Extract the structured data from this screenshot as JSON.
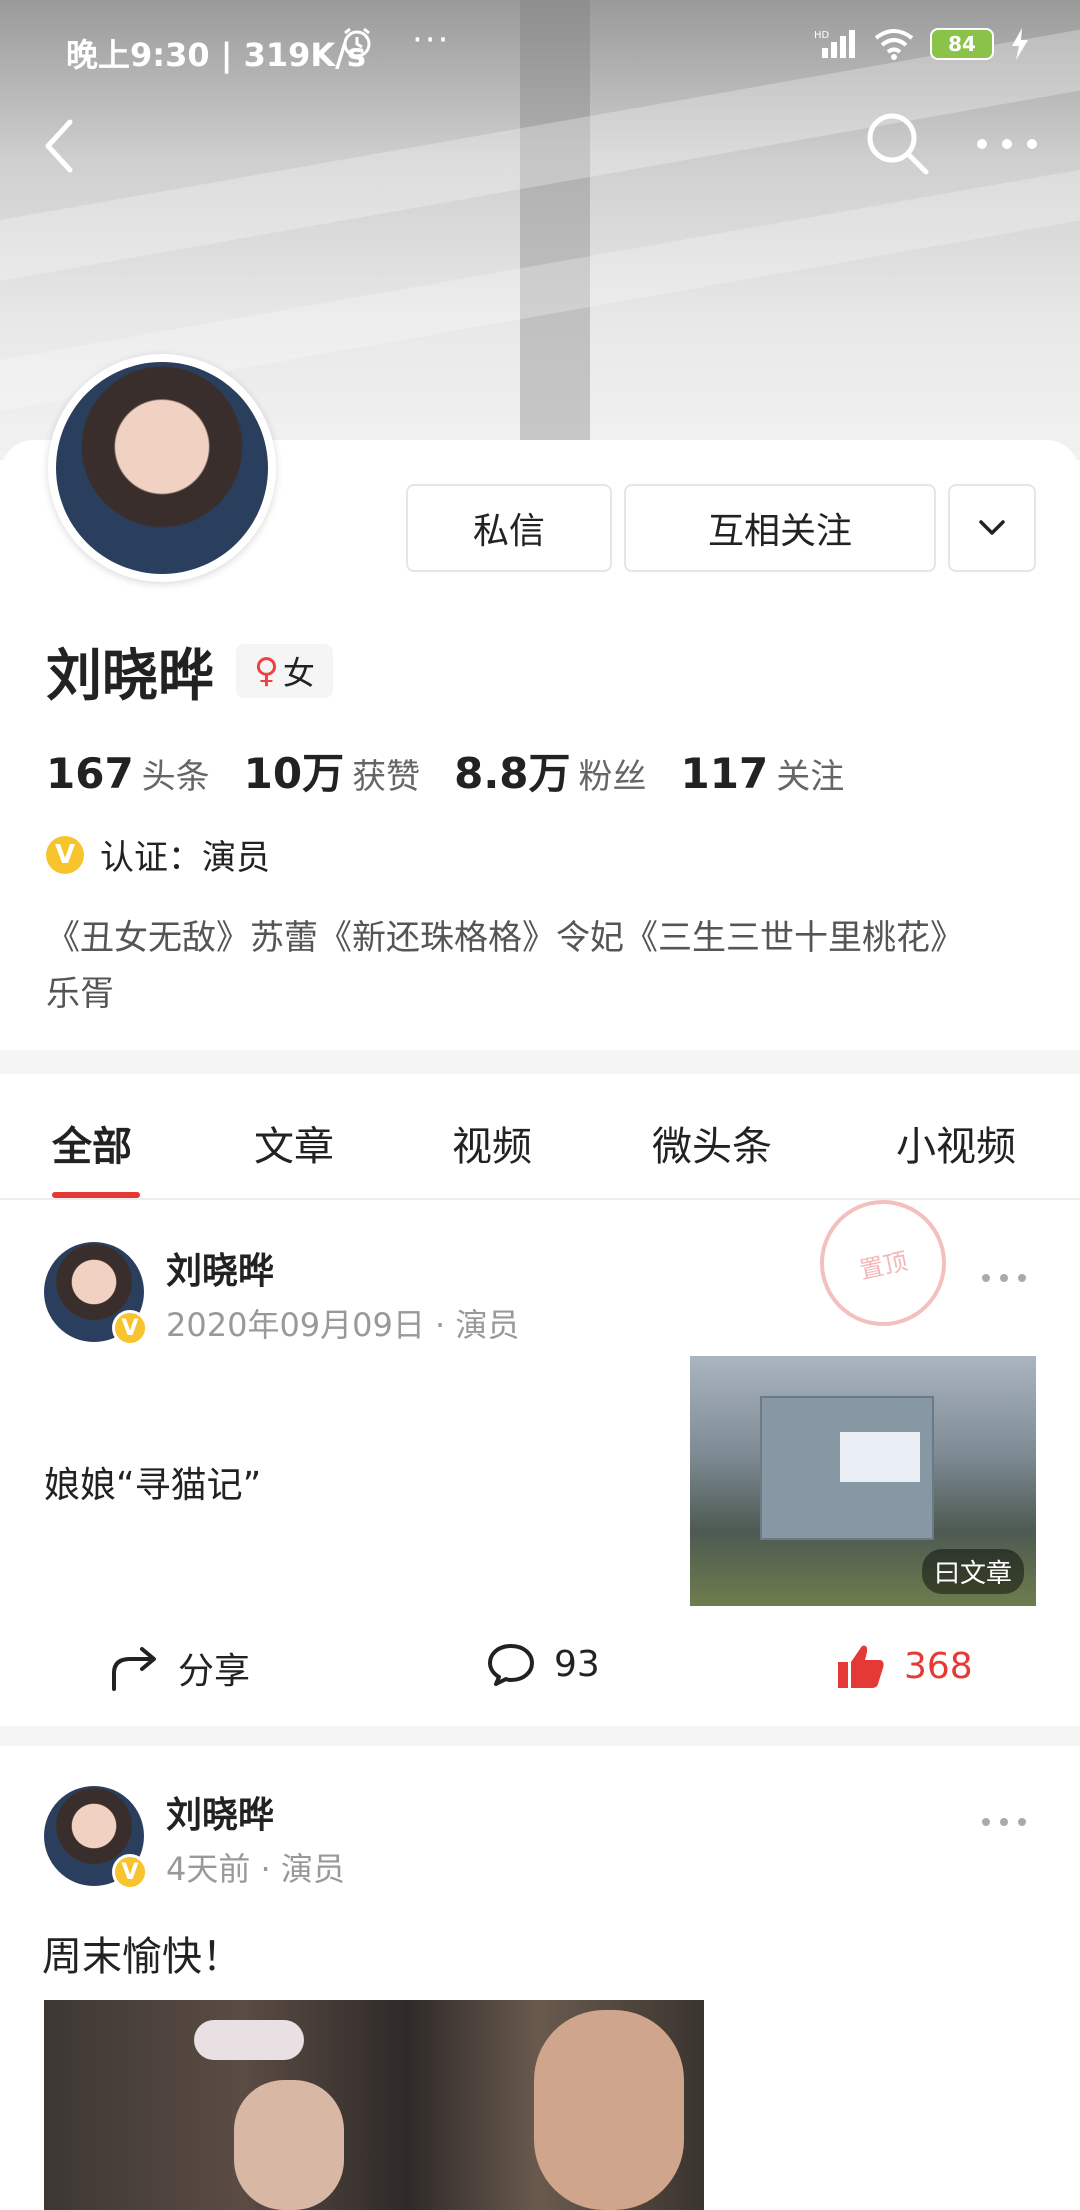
{
  "status_bar": {
    "time": "晚上9:30 | 319K/s",
    "dots": "···",
    "network": "HD",
    "battery": "84"
  },
  "profile": {
    "name": "刘晓晔",
    "gender_symbol": "♀",
    "gender": "女",
    "buttons": {
      "message": "私信",
      "follow": "互相关注"
    },
    "stats": [
      {
        "value": "167",
        "label": "头条"
      },
      {
        "value": "10万",
        "label": "获赞"
      },
      {
        "value": "8.8万",
        "label": "粉丝"
      },
      {
        "value": "117",
        "label": "关注"
      }
    ],
    "verification": {
      "badge": "V",
      "text": "认证：演员"
    },
    "bio": "《丑女无敌》苏蕾《新还珠格格》令妃《三生三世十里桃花》乐胥"
  },
  "tabs": [
    "全部",
    "文章",
    "视频",
    "微头条",
    "小视频"
  ],
  "active_tab": "全部",
  "posts": [
    {
      "author": "刘晓晔",
      "meta": "2020年09月09日 · 演员",
      "stamp": "置顶",
      "title": "娘娘“寻猫记”",
      "thumb_badge": "曰文章",
      "actions": {
        "share": "分享",
        "comments": "93",
        "likes": "368"
      }
    },
    {
      "author": "刘晓晔",
      "meta": "4天前 · 演员",
      "text": "周末愉快！"
    }
  ],
  "colors": {
    "accent": "#e53935",
    "verify": "#f7c42e"
  }
}
